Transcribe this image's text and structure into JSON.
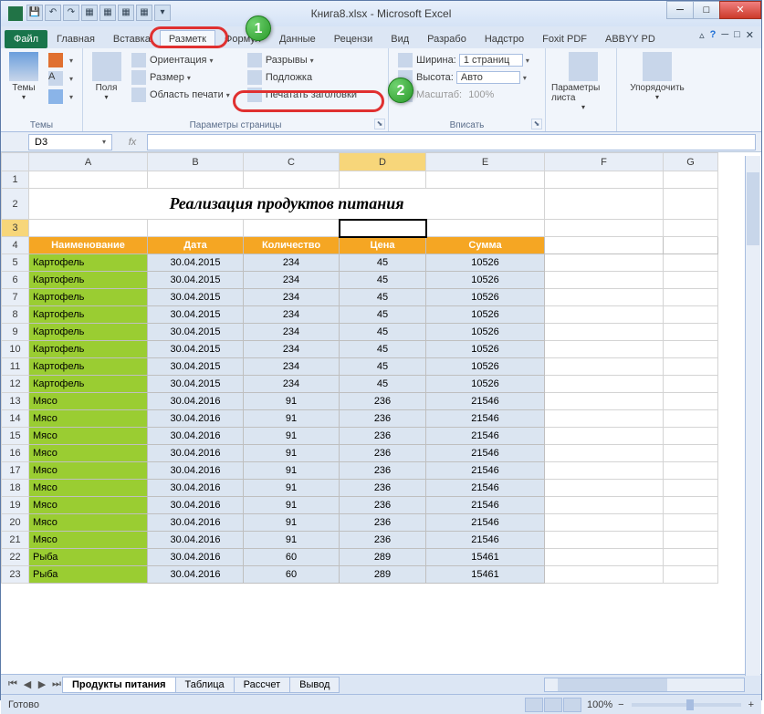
{
  "window": {
    "title": "Книга8.xlsx - Microsoft Excel"
  },
  "tabs": {
    "file": "Файл",
    "list": [
      "Главная",
      "Вставка",
      "Разметк",
      "Формул",
      "Данные",
      "Рецензи",
      "Вид",
      "Разрабо",
      "Надстро",
      "Foxit PDF",
      "ABBYY PD"
    ],
    "active_index": 2
  },
  "ribbon": {
    "themes": {
      "label": "Темы",
      "btn": "Темы"
    },
    "pagesetup": {
      "label": "Параметры страницы",
      "fields_big": "Поля",
      "orientation": "Ориентация",
      "size": "Размер",
      "printarea": "Область печати",
      "breaks": "Разрывы",
      "background": "Подложка",
      "printtitles": "Печатать заголовки"
    },
    "scale": {
      "label": "Вписать",
      "width_lbl": "Ширина:",
      "width_val": "1 страниц",
      "height_lbl": "Высота:",
      "height_val": "Авто",
      "scale_lbl": "Масштаб:",
      "scale_val": "100%"
    },
    "sheetopts": {
      "label": "",
      "btn": "Параметры листа"
    },
    "arrange": {
      "label": "",
      "btn": "Упорядочить"
    }
  },
  "callout": {
    "one": "1",
    "two": "2"
  },
  "namebox": "D3",
  "sheet": {
    "cols": [
      "A",
      "B",
      "C",
      "D",
      "E",
      "F",
      "G"
    ],
    "title": "Реализация продуктов питания",
    "headers": [
      "Наименование",
      "Дата",
      "Количество",
      "Цена",
      "Сумма"
    ],
    "rows": [
      {
        "n": "Картофель",
        "d": "30.04.2015",
        "q": "234",
        "p": "45",
        "s": "10526"
      },
      {
        "n": "Картофель",
        "d": "30.04.2015",
        "q": "234",
        "p": "45",
        "s": "10526"
      },
      {
        "n": "Картофель",
        "d": "30.04.2015",
        "q": "234",
        "p": "45",
        "s": "10526"
      },
      {
        "n": "Картофель",
        "d": "30.04.2015",
        "q": "234",
        "p": "45",
        "s": "10526"
      },
      {
        "n": "Картофель",
        "d": "30.04.2015",
        "q": "234",
        "p": "45",
        "s": "10526"
      },
      {
        "n": "Картофель",
        "d": "30.04.2015",
        "q": "234",
        "p": "45",
        "s": "10526"
      },
      {
        "n": "Картофель",
        "d": "30.04.2015",
        "q": "234",
        "p": "45",
        "s": "10526"
      },
      {
        "n": "Картофель",
        "d": "30.04.2015",
        "q": "234",
        "p": "45",
        "s": "10526"
      },
      {
        "n": "Мясо",
        "d": "30.04.2016",
        "q": "91",
        "p": "236",
        "s": "21546"
      },
      {
        "n": "Мясо",
        "d": "30.04.2016",
        "q": "91",
        "p": "236",
        "s": "21546"
      },
      {
        "n": "Мясо",
        "d": "30.04.2016",
        "q": "91",
        "p": "236",
        "s": "21546"
      },
      {
        "n": "Мясо",
        "d": "30.04.2016",
        "q": "91",
        "p": "236",
        "s": "21546"
      },
      {
        "n": "Мясо",
        "d": "30.04.2016",
        "q": "91",
        "p": "236",
        "s": "21546"
      },
      {
        "n": "Мясо",
        "d": "30.04.2016",
        "q": "91",
        "p": "236",
        "s": "21546"
      },
      {
        "n": "Мясо",
        "d": "30.04.2016",
        "q": "91",
        "p": "236",
        "s": "21546"
      },
      {
        "n": "Мясо",
        "d": "30.04.2016",
        "q": "91",
        "p": "236",
        "s": "21546"
      },
      {
        "n": "Мясо",
        "d": "30.04.2016",
        "q": "91",
        "p": "236",
        "s": "21546"
      },
      {
        "n": "Рыба",
        "d": "30.04.2016",
        "q": "60",
        "p": "289",
        "s": "15461"
      },
      {
        "n": "Рыба",
        "d": "30.04.2016",
        "q": "60",
        "p": "289",
        "s": "15461"
      }
    ]
  },
  "sheets": {
    "list": [
      "Продукты питания",
      "Таблица",
      "Рассчет",
      "Вывод"
    ],
    "active_index": 0
  },
  "status": {
    "ready": "Готово",
    "zoom": "100%"
  }
}
